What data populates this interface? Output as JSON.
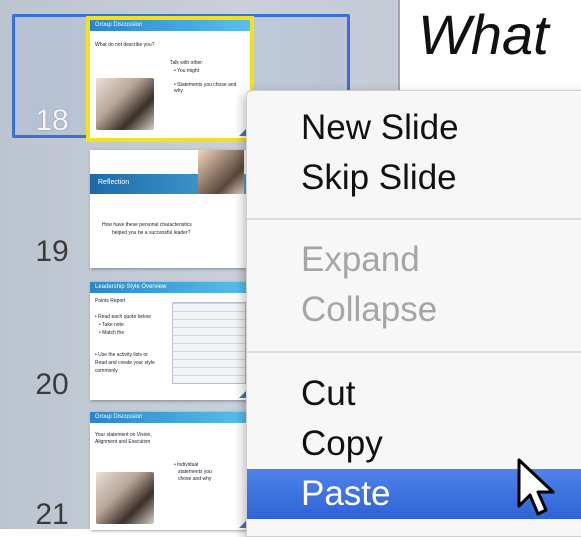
{
  "canvas": {
    "title": "What"
  },
  "slides": [
    {
      "number": "18",
      "title": "Group Discussion",
      "lines": [
        "What do not describe you?",
        "Talk with other:",
        "• You might",
        "• Statements you chose and why"
      ]
    },
    {
      "number": "19",
      "title": "Reflection",
      "lines": [
        "How have these personal characteristics",
        "helped you be a successful leader?"
      ]
    },
    {
      "number": "20",
      "title": "Leadership Style Overview",
      "lines": [
        "Points Report",
        "• Read each quote below",
        "• Take note",
        "• Match the",
        "• Use the activity lists or",
        "  Read and create your style",
        "  commonly"
      ]
    },
    {
      "number": "21",
      "title": "Group Discussion",
      "lines": [
        "Your statement on Vision,",
        "Alignment and Execution",
        "• Individual",
        "  statements you",
        "  chose and why"
      ]
    }
  ],
  "context_menu": {
    "items": [
      {
        "label": "New Slide"
      },
      {
        "label": "Skip Slide"
      },
      {
        "label": "Expand"
      },
      {
        "label": "Collapse"
      },
      {
        "label": "Cut"
      },
      {
        "label": "Copy"
      },
      {
        "label": "Paste"
      }
    ]
  }
}
